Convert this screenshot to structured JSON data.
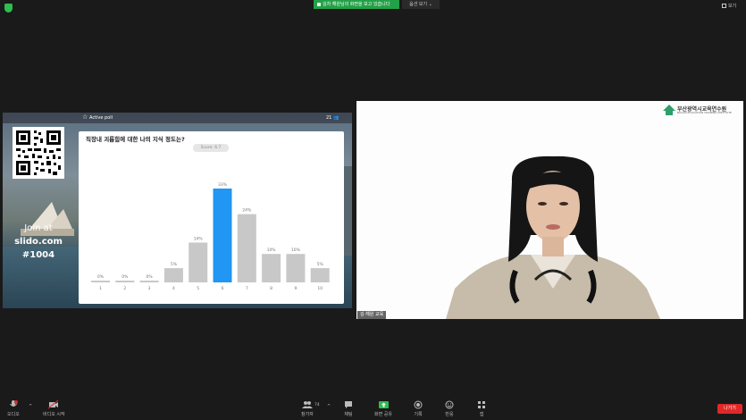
{
  "top_bar": {
    "share_banner": "김차 해원님의 화면을 보고 있습니다",
    "view_options": "옵션 보기 ⌄",
    "view_button": "보기"
  },
  "shared_screen": {
    "active_poll_label": "Active poll",
    "participant_count": "21 👥",
    "join_line1": "Join at",
    "join_line2": "slido.com",
    "join_line3": "#1004",
    "poll": {
      "question": "직장내 괴롭힘에 대한 나의 지식 정도는?",
      "score": "Score: 6.7"
    }
  },
  "chart_data": {
    "type": "bar",
    "categories": [
      "1",
      "2",
      "3",
      "4",
      "5",
      "6",
      "7",
      "8",
      "9",
      "10"
    ],
    "values": [
      0,
      0,
      0,
      5,
      14,
      33,
      24,
      10,
      10,
      5
    ],
    "data_labels": [
      "0%",
      "0%",
      "0%",
      "5%",
      "14%",
      "33%",
      "24%",
      "10%",
      "10%",
      "5%"
    ],
    "ylim": [
      0,
      33
    ],
    "highlight_index": 5,
    "colors": {
      "bar": "#c8c8c8",
      "highlight": "#2196f3"
    }
  },
  "speaker": {
    "org_name": "부산광역시교육연수원",
    "org_sub": "BUSAN EDUCATION TRAINING INSTITUTE",
    "name_tag": "김·해원 교육"
  },
  "toolbar": {
    "audio": "오디오",
    "video": "비디오 시작",
    "participants": "참가자",
    "participants_count": "74",
    "chat": "채팅",
    "share": "화면 공유",
    "record": "기록",
    "reactions": "반응",
    "apps": "앱",
    "leave": "나가기"
  },
  "colors": {
    "background": "#1a1a1a",
    "share_green": "#23a048",
    "leave_red": "#e02828"
  }
}
